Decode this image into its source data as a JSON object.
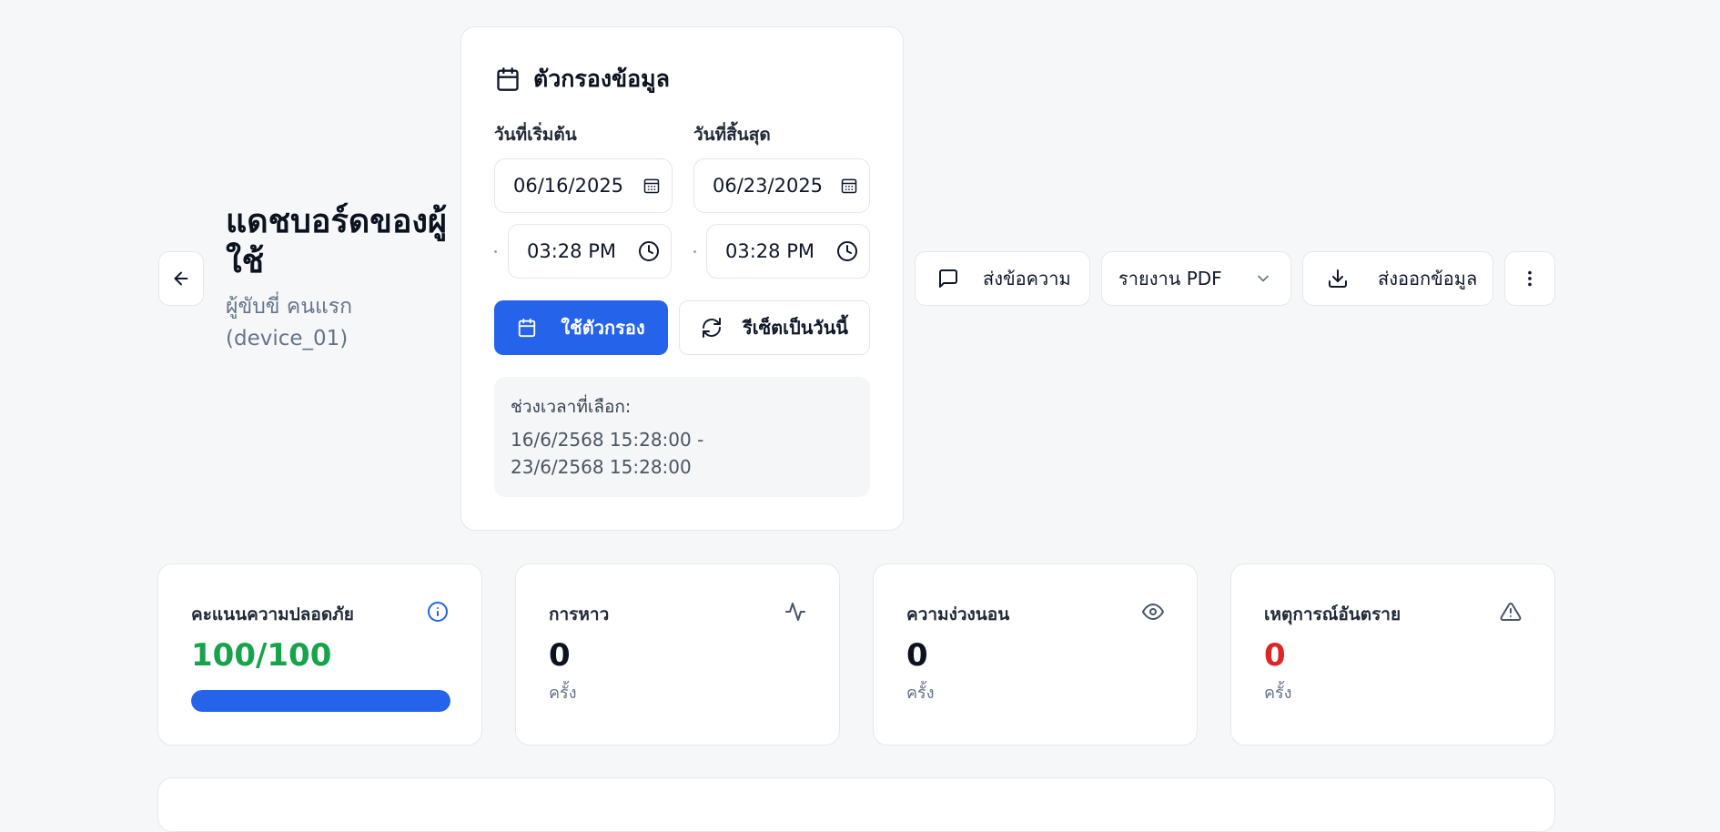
{
  "header": {
    "title": "แดชบอร์ดของผู้ใช้",
    "subtitle": "ผู้ขับขี่ คนแรก (device_01)"
  },
  "filter": {
    "title": "ตัวกรองข้อมูล",
    "start_label": "วันที่เริ่มต้น",
    "end_label": "วันที่สิ้นสุด",
    "start_date": "06/16/2025",
    "end_date": "06/23/2025",
    "start_time": "03:28 PM",
    "end_time": "03:28 PM",
    "apply_label": "ใช้ตัวกรอง",
    "reset_label": "รีเซ็ตเป็นวันนี้",
    "range_label": "ช่วงเวลาที่เลือก:",
    "range_value": "16/6/2568 15:28:00 - 23/6/2568 15:28:00"
  },
  "toolbar": {
    "message_label": "ส่งข้อความ",
    "report_select": "รายงาน PDF",
    "export_label": "ส่งออกข้อมูล"
  },
  "stats": {
    "safety": {
      "label": "คะแนนความปลอดภัย",
      "value": "100/100",
      "progress_percent": 100,
      "color": "#16a34a"
    },
    "yawn": {
      "label": "การหาว",
      "value": "0",
      "unit": "ครั้ง"
    },
    "drowsy": {
      "label": "ความง่วงนอน",
      "value": "0",
      "unit": "ครั้ง"
    },
    "danger": {
      "label": "เหตุการณ์อันตราย",
      "value": "0",
      "unit": "ครั้ง",
      "color": "#dc2626"
    }
  },
  "colors": {
    "accent": "#2563eb",
    "success": "#16a34a",
    "danger": "#dc2626"
  },
  "icons": [
    "back-arrow-icon",
    "calendar-icon",
    "clock-icon",
    "refresh-icon",
    "message-icon",
    "chevron-down-icon",
    "download-icon",
    "more-vertical-icon",
    "info-icon",
    "activity-icon",
    "eye-icon",
    "warning-icon"
  ]
}
